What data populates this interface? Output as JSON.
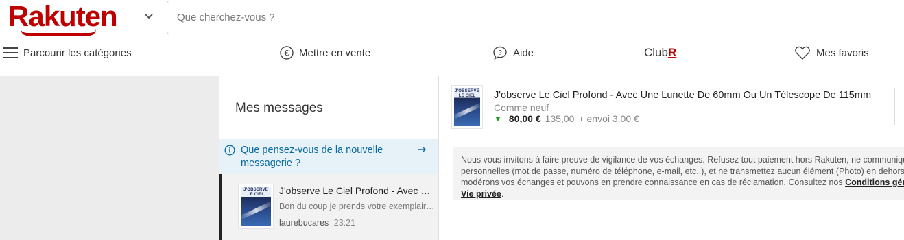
{
  "header": {
    "logo": "Rakuten",
    "search_placeholder": "Que cherchez-vous ?",
    "nav": {
      "categories": "Parcourir les catégories",
      "sell": "Mettre en vente",
      "help": "Aide",
      "club": "Club",
      "club_r": "R",
      "favorites": "Mes favoris"
    }
  },
  "inbox": {
    "title": "Mes messages",
    "feedback": "Que pensez-vous de la nouvelle messagerie ?",
    "conversation": {
      "title": "J'observe Le Ciel Profond - Avec Une Lunette De 60mm Ou Un Télescope De 115mm",
      "preview": "Bon du coup je prends votre exemplaire, j...",
      "user": "laurebucares",
      "time": "23:21",
      "cover_title": "J'OBSERVE LE CIEL PROFOND"
    }
  },
  "product": {
    "title": "J'observe Le Ciel Profond - Avec Une Lunette De 60mm Ou Un Télescope De 115mm",
    "condition": "Comme neuf",
    "price": "80,00 €",
    "old_price": "135,00",
    "shipping": "+ envoi 3,00 €",
    "cover_title": "J'OBSERVE LE CIEL PROFOND"
  },
  "notice": {
    "line1": "Nous vous invitons à faire preuve de vigilance de vos échanges. Refusez tout paiement hors Rakuten, ne communiquez aucune donnée",
    "line2": "personnelles (mot de passe, numéro de téléphone, e-mail, etc..), et ne transmettez aucun élément (Photo) en dehors de la plateforme. Nous",
    "line3": "modérons vos échanges et pouvons en prendre connaissance en cas de réclamation. Consultez nos",
    "link1": "Conditions générales",
    "link2": "Vie privée",
    "end": "."
  },
  "colors": {
    "brand": "#bf0000",
    "link": "#0a6aa1",
    "feedback_bg": "#e6f2f8"
  }
}
